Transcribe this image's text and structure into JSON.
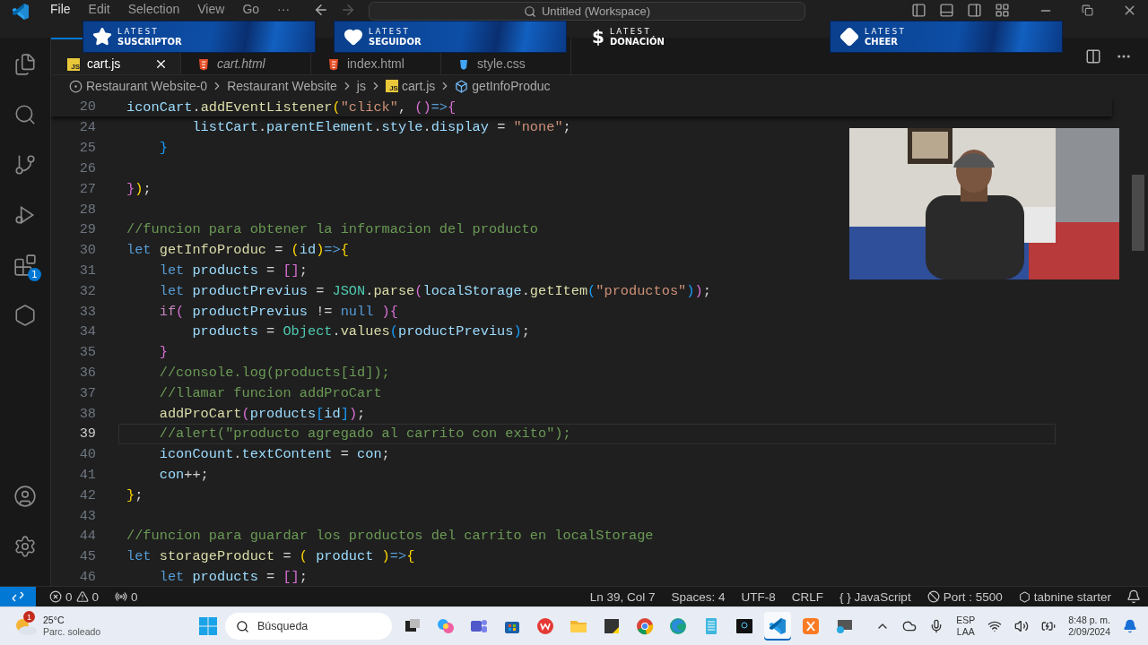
{
  "title_bar": {
    "menu": [
      "File",
      "Edit",
      "Selection",
      "View",
      "Go",
      "···"
    ],
    "search": "Untitled (Workspace)"
  },
  "stream_overlays": [
    {
      "kind": "star",
      "top": "LATEST",
      "label": "SUSCRIPTOR"
    },
    {
      "kind": "heart",
      "top": "LATEST",
      "label": "SEGUIDOR"
    },
    {
      "kind": "dollar",
      "symbol": "$",
      "top": "LATEST",
      "label": "DONACIÓN"
    },
    {
      "kind": "diamond",
      "top": "LATEST",
      "label": "CHEER"
    }
  ],
  "activity_bar": {
    "items": [
      {
        "kind": "explorer"
      },
      {
        "kind": "search"
      },
      {
        "kind": "source-control"
      },
      {
        "kind": "run"
      },
      {
        "kind": "extensions",
        "badge": "1"
      },
      {
        "kind": "hexagon"
      }
    ],
    "bottom": [
      {
        "kind": "account"
      },
      {
        "kind": "settings"
      }
    ]
  },
  "tabs": [
    {
      "label": "cart.js",
      "kind": "js",
      "icon_text": "JS",
      "selected": true,
      "preview": false
    },
    {
      "label": "cart.html",
      "kind": "html",
      "selected": false,
      "preview": true
    },
    {
      "label": "index.html",
      "kind": "html",
      "selected": false,
      "preview": false
    },
    {
      "label": "style.css",
      "kind": "css",
      "selected": false,
      "preview": false
    }
  ],
  "breadcrumb": [
    {
      "kind": "root",
      "label": "Restaurant Website-0"
    },
    {
      "kind": "folder",
      "label": "Restaurant Website"
    },
    {
      "kind": "folder",
      "label": "js"
    },
    {
      "kind": "js",
      "icon_text": "JS",
      "label": "cart.js"
    },
    {
      "kind": "symbol",
      "label": "getInfoProduc"
    }
  ],
  "editor": {
    "sticky": {
      "number": "20",
      "tokens": [
        {
          "kind": "var",
          "text": "iconCart"
        },
        {
          "kind": "punct",
          "text": "."
        },
        {
          "kind": "fn",
          "text": "addEventListener"
        },
        {
          "kind": "b1",
          "text": "("
        },
        {
          "kind": "str",
          "text": "\"click\""
        },
        {
          "kind": "punct",
          "text": ", "
        },
        {
          "kind": "b2",
          "text": "()"
        },
        {
          "kind": "kw",
          "text": "=>"
        },
        {
          "kind": "b2",
          "text": "{"
        }
      ]
    },
    "lines": [
      {
        "number": "24",
        "current": false,
        "tokens": [
          {
            "kind": "var",
            "text": "        listCart"
          },
          {
            "kind": "punct",
            "text": "."
          },
          {
            "kind": "var",
            "text": "parentElement"
          },
          {
            "kind": "punct",
            "text": "."
          },
          {
            "kind": "var",
            "text": "style"
          },
          {
            "kind": "punct",
            "text": "."
          },
          {
            "kind": "var",
            "text": "display"
          },
          {
            "kind": "punct",
            "text": " = "
          },
          {
            "kind": "str",
            "text": "\"none\""
          },
          {
            "kind": "punct",
            "text": ";"
          }
        ]
      },
      {
        "number": "25",
        "current": false,
        "tokens": [
          {
            "kind": "b3",
            "text": "    }"
          }
        ]
      },
      {
        "number": "26",
        "current": false
      },
      {
        "number": "27",
        "current": false,
        "tokens": [
          {
            "kind": "b2",
            "text": "}"
          },
          {
            "kind": "b1",
            "text": ")"
          },
          {
            "kind": "punct",
            "text": ";"
          }
        ]
      },
      {
        "number": "28",
        "current": false
      },
      {
        "number": "29",
        "current": false,
        "tokens": [
          {
            "kind": "comment",
            "text": "//funcion para obtener la informacion del producto"
          }
        ]
      },
      {
        "number": "30",
        "current": false,
        "tokens": [
          {
            "kind": "kw",
            "text": "let "
          },
          {
            "kind": "fn",
            "text": "getInfoProduc"
          },
          {
            "kind": "punct",
            "text": " = "
          },
          {
            "kind": "b1",
            "text": "("
          },
          {
            "kind": "var",
            "text": "id"
          },
          {
            "kind": "b1",
            "text": ")"
          },
          {
            "kind": "kw",
            "text": "=>"
          },
          {
            "kind": "b1",
            "text": "{"
          }
        ]
      },
      {
        "number": "31",
        "current": false,
        "tokens": [
          {
            "kind": "kw",
            "text": "    let "
          },
          {
            "kind": "var",
            "text": "products"
          },
          {
            "kind": "punct",
            "text": " = "
          },
          {
            "kind": "b2",
            "text": "[]"
          },
          {
            "kind": "punct",
            "text": ";"
          }
        ]
      },
      {
        "number": "32",
        "current": false,
        "tokens": [
          {
            "kind": "kw",
            "text": "    let "
          },
          {
            "kind": "var",
            "text": "productPrevius"
          },
          {
            "kind": "punct",
            "text": " = "
          },
          {
            "kind": "cls",
            "text": "JSON"
          },
          {
            "kind": "punct",
            "text": "."
          },
          {
            "kind": "fn",
            "text": "parse"
          },
          {
            "kind": "b2",
            "text": "("
          },
          {
            "kind": "var",
            "text": "localStorage"
          },
          {
            "kind": "punct",
            "text": "."
          },
          {
            "kind": "fn",
            "text": "getItem"
          },
          {
            "kind": "b3",
            "text": "("
          },
          {
            "kind": "str",
            "text": "\"productos\""
          },
          {
            "kind": "b3",
            "text": ")"
          },
          {
            "kind": "b2",
            "text": ")"
          },
          {
            "kind": "punct",
            "text": ";"
          }
        ]
      },
      {
        "number": "33",
        "current": false,
        "tokens": [
          {
            "kind": "ctrl",
            "text": "    if"
          },
          {
            "kind": "b2",
            "text": "("
          },
          {
            "kind": "var",
            "text": " productPrevius"
          },
          {
            "kind": "punct",
            "text": " != "
          },
          {
            "kind": "kw",
            "text": "null "
          },
          {
            "kind": "b2",
            "text": ")"
          },
          {
            "kind": "b2",
            "text": "{"
          }
        ]
      },
      {
        "number": "34",
        "current": false,
        "tokens": [
          {
            "kind": "var",
            "text": "        products"
          },
          {
            "kind": "punct",
            "text": " = "
          },
          {
            "kind": "cls",
            "text": "Object"
          },
          {
            "kind": "punct",
            "text": "."
          },
          {
            "kind": "fn",
            "text": "values"
          },
          {
            "kind": "b3",
            "text": "("
          },
          {
            "kind": "var",
            "text": "productPrevius"
          },
          {
            "kind": "b3",
            "text": ")"
          },
          {
            "kind": "punct",
            "text": ";"
          }
        ]
      },
      {
        "number": "35",
        "current": false,
        "tokens": [
          {
            "kind": "b2",
            "text": "    }"
          }
        ]
      },
      {
        "number": "36",
        "current": false,
        "tokens": [
          {
            "kind": "comment",
            "text": "    //console.log(products[id]);"
          }
        ]
      },
      {
        "number": "37",
        "current": false,
        "tokens": [
          {
            "kind": "comment",
            "text": "    //llamar funcion addProCart"
          }
        ]
      },
      {
        "number": "38",
        "current": false,
        "tokens": [
          {
            "kind": "fn",
            "text": "    addProCart"
          },
          {
            "kind": "b2",
            "text": "("
          },
          {
            "kind": "var",
            "text": "products"
          },
          {
            "kind": "b3",
            "text": "["
          },
          {
            "kind": "var",
            "text": "id"
          },
          {
            "kind": "b3",
            "text": "]"
          },
          {
            "kind": "b2",
            "text": ")"
          },
          {
            "kind": "punct",
            "text": ";"
          }
        ]
      },
      {
        "number": "39",
        "current": true,
        "tokens": [
          {
            "kind": "comment",
            "text": "    //alert(\"producto agregado al carrito con exito\");"
          }
        ]
      },
      {
        "number": "40",
        "current": false,
        "tokens": [
          {
            "kind": "var",
            "text": "    iconCount"
          },
          {
            "kind": "punct",
            "text": "."
          },
          {
            "kind": "var",
            "text": "textContent"
          },
          {
            "kind": "punct",
            "text": " = "
          },
          {
            "kind": "var",
            "text": "con"
          },
          {
            "kind": "punct",
            "text": ";"
          }
        ]
      },
      {
        "number": "41",
        "current": false,
        "tokens": [
          {
            "kind": "var",
            "text": "    con"
          },
          {
            "kind": "punct",
            "text": "++;"
          }
        ]
      },
      {
        "number": "42",
        "current": false,
        "tokens": [
          {
            "kind": "b1",
            "text": "}"
          },
          {
            "kind": "punct",
            "text": ";"
          }
        ]
      },
      {
        "number": "43",
        "current": false
      },
      {
        "number": "44",
        "current": false,
        "tokens": [
          {
            "kind": "comment",
            "text": "//funcion para guardar los productos del carrito en localStorage"
          }
        ]
      },
      {
        "number": "45",
        "current": false,
        "tokens": [
          {
            "kind": "kw",
            "text": "let "
          },
          {
            "kind": "fn",
            "text": "storageProduct"
          },
          {
            "kind": "punct",
            "text": " = "
          },
          {
            "kind": "b1",
            "text": "("
          },
          {
            "kind": "var",
            "text": " product "
          },
          {
            "kind": "b1",
            "text": ")"
          },
          {
            "kind": "kw",
            "text": "=>"
          },
          {
            "kind": "b1",
            "text": "{"
          }
        ]
      },
      {
        "number": "46",
        "current": false,
        "tokens": [
          {
            "kind": "kw",
            "text": "    let "
          },
          {
            "kind": "var",
            "text": "products"
          },
          {
            "kind": "punct",
            "text": " = "
          },
          {
            "kind": "b2",
            "text": "[]"
          },
          {
            "kind": "punct",
            "text": ";"
          }
        ]
      }
    ]
  },
  "status_bar": {
    "errors": "0",
    "warnings": "0",
    "ports": "0",
    "right": [
      {
        "kind": "text",
        "label": "Ln 39, Col 7"
      },
      {
        "kind": "text",
        "label": "Spaces: 4"
      },
      {
        "kind": "text",
        "label": "UTF-8"
      },
      {
        "kind": "text",
        "label": "CRLF"
      },
      {
        "kind": "language",
        "glyph": "{ }",
        "label": "JavaScript"
      },
      {
        "kind": "port",
        "label": "Port : 5500"
      },
      {
        "kind": "tabnine",
        "label": "tabnine starter"
      },
      {
        "kind": "bell"
      }
    ]
  },
  "taskbar": {
    "weather": {
      "badge": "1",
      "temp": "25°C",
      "condition": "Parc. soleado"
    },
    "search": {
      "placeholder": "Búsqueda"
    },
    "apps": [
      {
        "kind": "task-view",
        "selected": false
      },
      {
        "kind": "copilot",
        "selected": false
      },
      {
        "kind": "teams",
        "selected": false
      },
      {
        "kind": "store",
        "selected": false
      },
      {
        "kind": "wps",
        "selected": false
      },
      {
        "kind": "folder",
        "selected": false
      },
      {
        "kind": "notes",
        "selected": false
      },
      {
        "kind": "chrome",
        "selected": false
      },
      {
        "kind": "edge",
        "selected": false
      },
      {
        "kind": "notepad",
        "selected": false
      },
      {
        "kind": "terminal",
        "selected": false
      },
      {
        "kind": "vscode",
        "selected": true
      },
      {
        "kind": "xampp",
        "selected": false
      },
      {
        "kind": "remote",
        "selected": false
      }
    ],
    "tray": {
      "lang": "ESP",
      "layout": "LAA",
      "time": "8:48 p. m.",
      "date": "2/09/2024"
    }
  }
}
